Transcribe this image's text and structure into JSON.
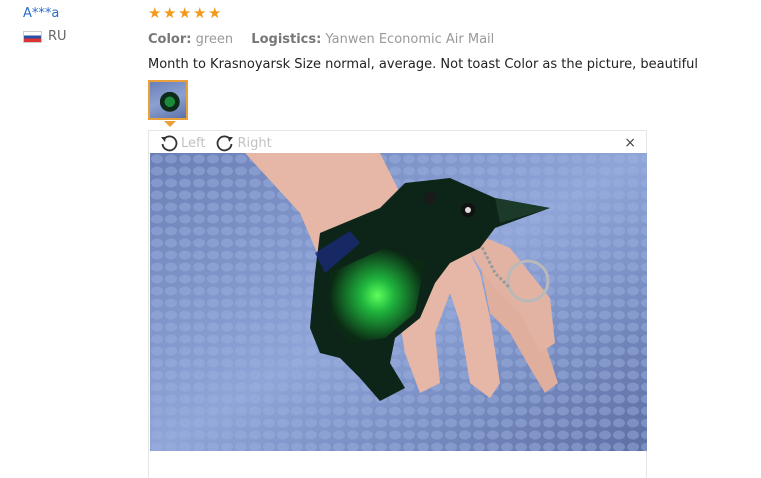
{
  "user": {
    "name": "A***a",
    "country": "RU",
    "flag_icon": "russia-flag-icon"
  },
  "review": {
    "rating": 5,
    "stars": [
      "star",
      "star",
      "star",
      "star",
      "star"
    ],
    "color_label": "Color:",
    "color_value": "green",
    "logistics_label": "Logistics:",
    "logistics_value": "Yanwen Economic Air Mail",
    "text": "Month to Krasnoyarsk Size normal, average. Not toast Color as the picture, beautiful"
  },
  "viewer": {
    "rotate_left": "Left",
    "rotate_right": "Right",
    "close_symbol": "×"
  },
  "colors": {
    "star": "#f39a1c",
    "username": "#2b6cc4",
    "thumb_border": "#e7a03a"
  }
}
